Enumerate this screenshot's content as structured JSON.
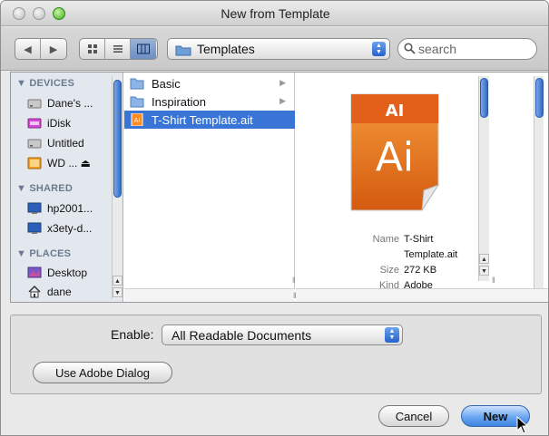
{
  "window": {
    "title": "New from Template"
  },
  "toolbar": {
    "back_glyph": "◀",
    "forward_glyph": "▶",
    "view_modes": [
      "icon",
      "list",
      "column"
    ],
    "active_view": "column",
    "path_popup": "Templates",
    "search_placeholder": "search"
  },
  "sidebar": {
    "sections": [
      {
        "heading": "▼ DEVICES",
        "items": [
          {
            "label": "Dane's ...",
            "icon": "hard-drive-icon"
          },
          {
            "label": "iDisk",
            "icon": "idisk-icon"
          },
          {
            "label": "Untitled",
            "icon": "hard-drive-icon"
          },
          {
            "label": "WD ...  ⏏",
            "icon": "external-drive-icon"
          }
        ]
      },
      {
        "heading": "▼ SHARED",
        "items": [
          {
            "label": "hp2001...",
            "icon": "network-computer-icon"
          },
          {
            "label": "x3ety-d...",
            "icon": "network-computer-icon"
          }
        ]
      },
      {
        "heading": "▼ PLACES",
        "items": [
          {
            "label": "Desktop",
            "icon": "desktop-icon"
          },
          {
            "label": "dane",
            "icon": "home-icon"
          }
        ]
      }
    ]
  },
  "column": {
    "items": [
      {
        "label": "Basic",
        "type": "folder",
        "has_children": true
      },
      {
        "label": "Inspiration",
        "type": "folder",
        "has_children": true
      },
      {
        "label": "T-Shirt Template.ait",
        "type": "ai-template",
        "selected": true
      }
    ]
  },
  "preview": {
    "icon_top": "AI",
    "icon_main": "Ai",
    "name_key": "Name",
    "name_val_1": "T-Shirt",
    "name_val_2": "Template.ait",
    "size_key": "Size",
    "size_val": "272 KB",
    "kind_key": "Kind",
    "kind_val": "Adobe"
  },
  "lower": {
    "enable_label": "Enable:",
    "enable_value": "All Readable Documents",
    "adobe_dialog_button": "Use Adobe Dialog"
  },
  "buttons": {
    "cancel": "Cancel",
    "new": "New"
  },
  "colors": {
    "selection": "#3875d7",
    "accent": "#2f6bc9",
    "ai_orange": "#e86b1d"
  }
}
